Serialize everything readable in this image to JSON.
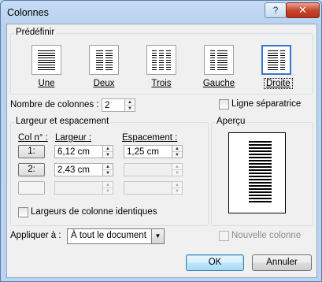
{
  "window": {
    "title": "Colonnes",
    "help_label": "?",
    "close_label": "✕"
  },
  "presets": {
    "group_label": "Prédéfinir",
    "items": [
      {
        "label": "Une",
        "icon": "one-column-icon"
      },
      {
        "label": "Deux",
        "icon": "two-columns-icon"
      },
      {
        "label": "Trois",
        "icon": "three-columns-icon"
      },
      {
        "label": "Gauche",
        "icon": "left-column-icon"
      },
      {
        "label": "Droite",
        "icon": "right-column-icon",
        "selected": true
      }
    ]
  },
  "num_columns": {
    "label": "Nombre de colonnes :",
    "value": "2"
  },
  "separator_line": {
    "label": "Ligne séparatrice",
    "checked": false
  },
  "width_spacing": {
    "group_label": "Largeur et espacement",
    "col_header": "Col n° :",
    "width_header": "Largeur :",
    "spacing_header": "Espacement :",
    "rows": [
      {
        "num": "1:",
        "width": "6,12 cm",
        "spacing": "1,25 cm"
      },
      {
        "num": "2:",
        "width": "2,43 cm",
        "spacing": ""
      },
      {
        "num": "",
        "width": "",
        "spacing": ""
      }
    ],
    "equal_width": {
      "label": "Largeurs de colonne identiques",
      "checked": false
    }
  },
  "preview": {
    "label": "Aperçu"
  },
  "apply_to": {
    "label": "Appliquer à :",
    "value": "À tout le document"
  },
  "new_column": {
    "label": "Nouvelle colonne",
    "checked": false
  },
  "buttons": {
    "ok": "OK",
    "cancel": "Annuler"
  }
}
